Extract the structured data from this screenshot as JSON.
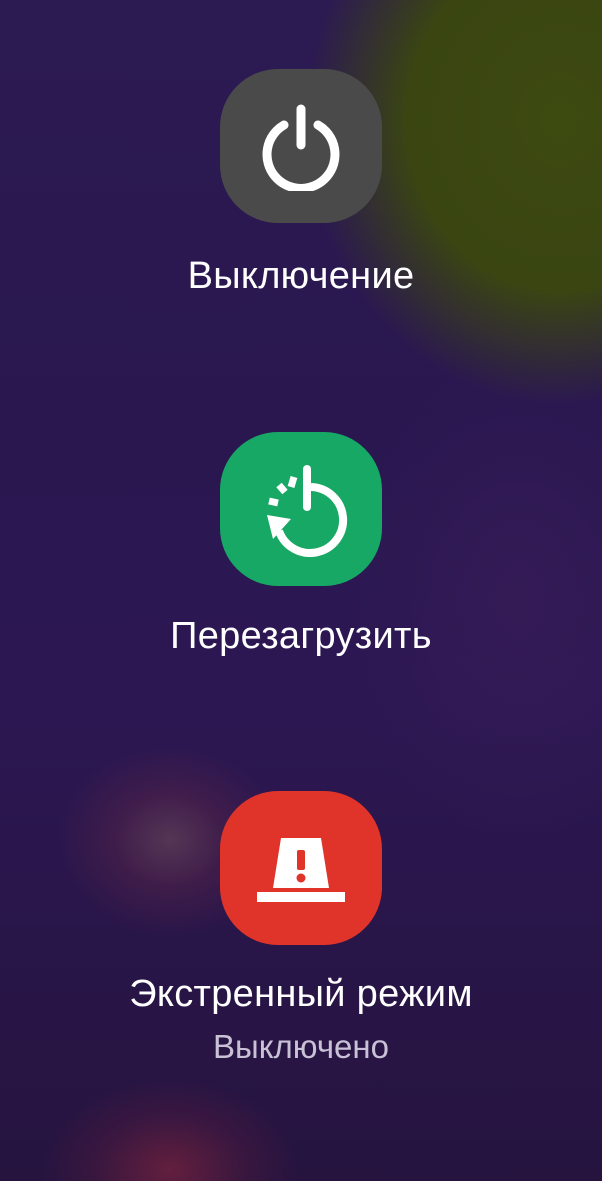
{
  "power_menu": {
    "power_off": {
      "label": "Выключение",
      "icon": "power-icon",
      "color": "#4a4a4a"
    },
    "restart": {
      "label": "Перезагрузить",
      "icon": "restart-icon",
      "color": "#17a865"
    },
    "emergency": {
      "label": "Экстренный режим",
      "status": "Выключено",
      "icon": "emergency-beacon-icon",
      "color": "#e0342a"
    }
  }
}
